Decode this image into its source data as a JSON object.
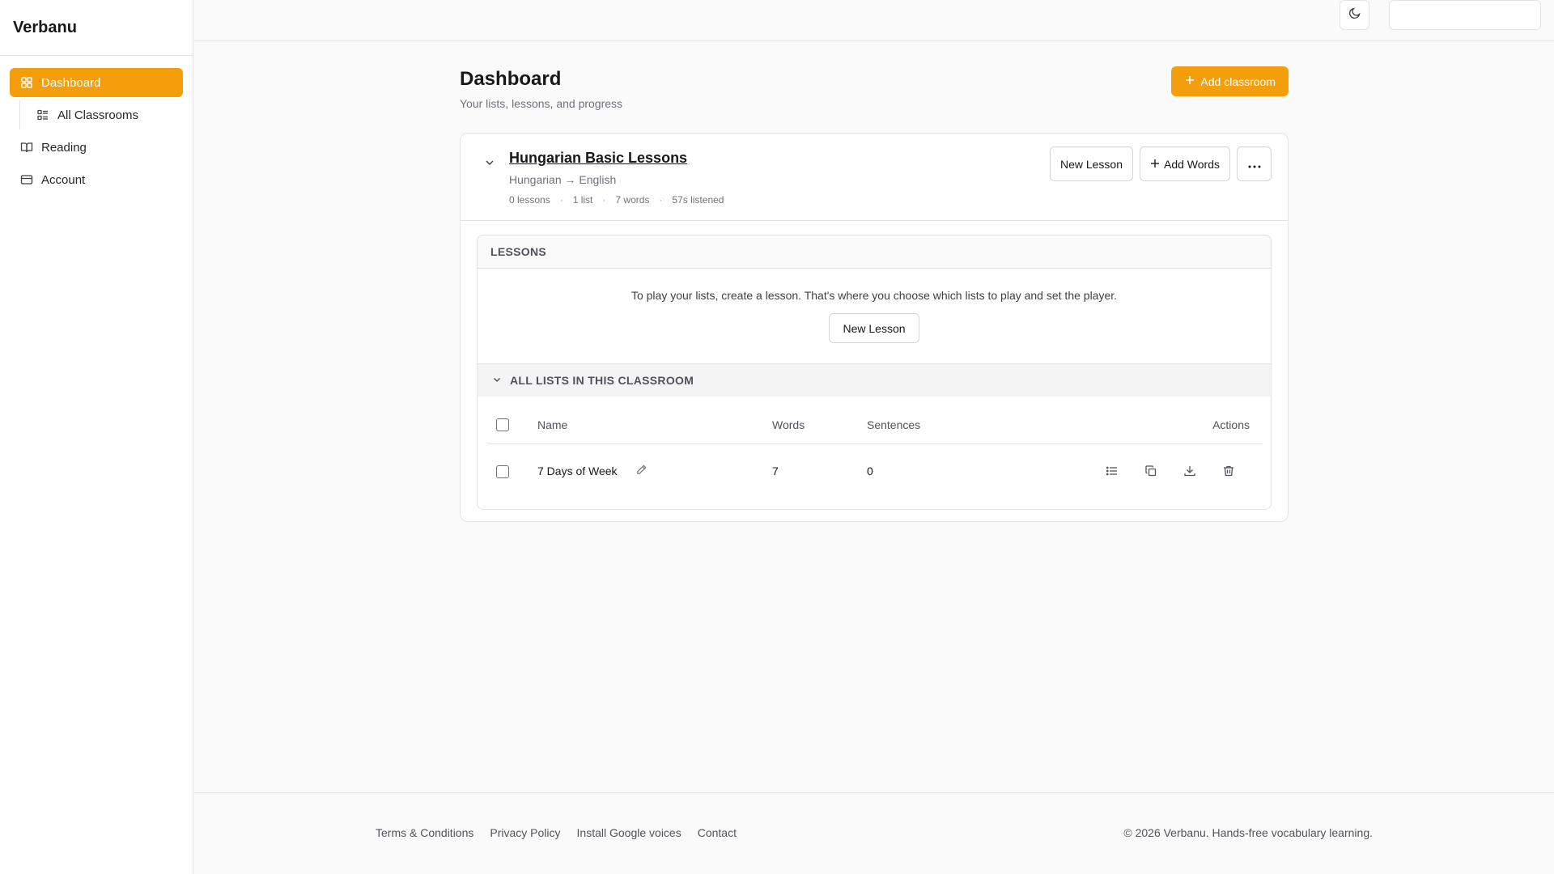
{
  "app": {
    "name": "Verbanu"
  },
  "sidebar": {
    "items": [
      {
        "label": "Dashboard",
        "icon": "grid-icon",
        "active": true
      },
      {
        "label": "All Classrooms",
        "icon": "list-icon",
        "sub": true
      },
      {
        "label": "Reading",
        "icon": "book-icon"
      },
      {
        "label": "Account",
        "icon": "card-icon"
      }
    ]
  },
  "topbar": {
    "theme_icon": "moon-icon",
    "search_value": ""
  },
  "page": {
    "title": "Dashboard",
    "subtitle": "Your lists, lessons, and progress",
    "add_classroom_label": "Add classroom"
  },
  "classroom": {
    "title": "Hungarian Basic Lessons",
    "languages": "Hungarian → English",
    "stats": [
      "0 lessons",
      "1 list",
      "7 words",
      "57s listened"
    ],
    "new_lesson_label": "New Lesson",
    "add_words_label": "Add Words",
    "more_icon": "ellipsis-icon"
  },
  "lessons": {
    "heading": "LESSONS",
    "empty_text": "To play your lists, create a lesson. That's where you choose which lists to play and set the player.",
    "new_lesson_label": "New Lesson"
  },
  "all_lists": {
    "heading": "ALL LISTS IN THIS CLASSROOM",
    "columns": [
      "Name",
      "Words",
      "Sentences",
      "Actions"
    ],
    "rows": [
      {
        "name": "7 Days of Week",
        "words": "7",
        "sentences": "0"
      }
    ]
  },
  "footer": {
    "links": [
      "Terms & Conditions",
      "Privacy Policy",
      "Install Google voices",
      "Contact"
    ],
    "copyright": "© 2026 Verbanu. Hands-free vocabulary learning."
  },
  "colors": {
    "accent": "#f59e0b",
    "border": "#e4e4e7",
    "muted": "#71717a"
  }
}
